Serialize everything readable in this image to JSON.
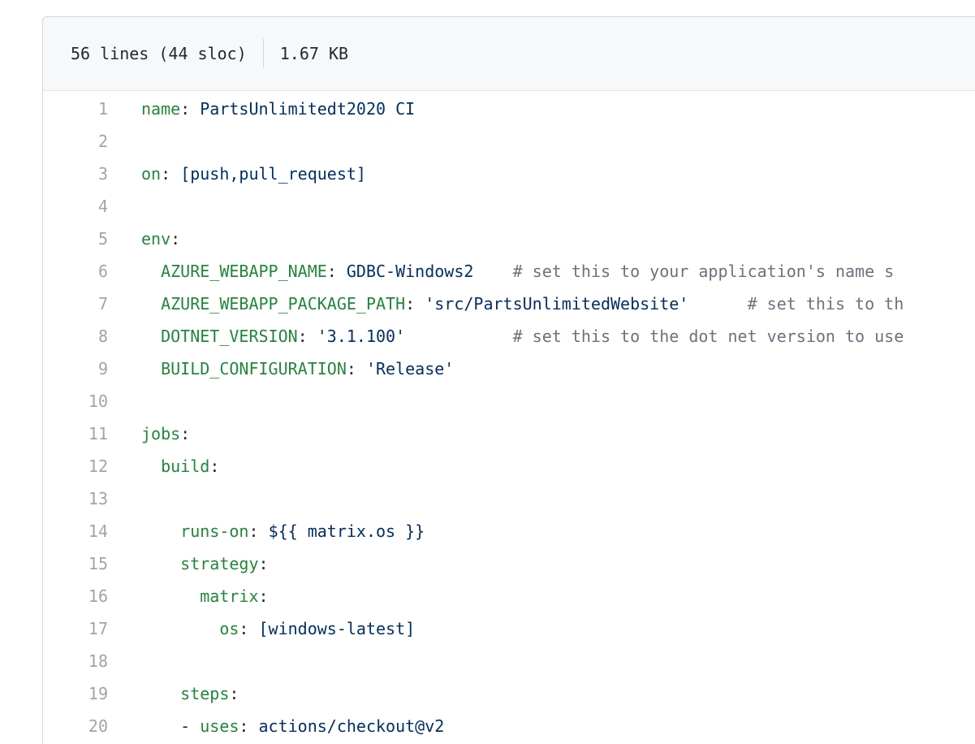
{
  "file_info": {
    "lines_sloc": "56 lines (44 sloc)",
    "size": "1.67 KB"
  },
  "colors": {
    "key": "#22863a",
    "string": "#032f62",
    "comment": "#6a737d",
    "line_number": "#a0a4a9",
    "header_bg": "#f6f8fa"
  },
  "lines": [
    {
      "n": "1",
      "indent": "",
      "key": "name",
      "sep": ": ",
      "val": "PartsUnlimitedt2020 CI",
      "comment": ""
    },
    {
      "n": "2",
      "indent": "",
      "key": "",
      "sep": "",
      "val": "",
      "comment": ""
    },
    {
      "n": "3",
      "indent": "",
      "key": "on",
      "sep": ": ",
      "val": "[push,pull_request]",
      "comment": ""
    },
    {
      "n": "4",
      "indent": "",
      "key": "",
      "sep": "",
      "val": "",
      "comment": ""
    },
    {
      "n": "5",
      "indent": "",
      "key": "env",
      "sep": ":",
      "val": "",
      "comment": ""
    },
    {
      "n": "6",
      "indent": "  ",
      "key": "AZURE_WEBAPP_NAME",
      "sep": ": ",
      "val": "GDBC-Windows2    ",
      "comment": "# set this to your application's name s"
    },
    {
      "n": "7",
      "indent": "  ",
      "key": "AZURE_WEBAPP_PACKAGE_PATH",
      "sep": ": ",
      "val": "'src/PartsUnlimitedWebsite'      ",
      "comment": "# set this to th"
    },
    {
      "n": "8",
      "indent": "  ",
      "key": "DOTNET_VERSION",
      "sep": ": ",
      "val": "'3.1.100'           ",
      "comment": "# set this to the dot net version to use"
    },
    {
      "n": "9",
      "indent": "  ",
      "key": "BUILD_CONFIGURATION",
      "sep": ": ",
      "val": "'Release'",
      "comment": ""
    },
    {
      "n": "10",
      "indent": "",
      "key": "",
      "sep": "",
      "val": "",
      "comment": ""
    },
    {
      "n": "11",
      "indent": "",
      "key": "jobs",
      "sep": ":",
      "val": "",
      "comment": ""
    },
    {
      "n": "12",
      "indent": "  ",
      "key": "build",
      "sep": ":",
      "val": "",
      "comment": ""
    },
    {
      "n": "13",
      "indent": "",
      "key": "",
      "sep": "",
      "val": "",
      "comment": ""
    },
    {
      "n": "14",
      "indent": "    ",
      "key": "runs-on",
      "sep": ": ",
      "val": "${{ matrix.os }}",
      "comment": ""
    },
    {
      "n": "15",
      "indent": "    ",
      "key": "strategy",
      "sep": ":",
      "val": "",
      "comment": ""
    },
    {
      "n": "16",
      "indent": "      ",
      "key": "matrix",
      "sep": ":",
      "val": "",
      "comment": ""
    },
    {
      "n": "17",
      "indent": "        ",
      "key": "os",
      "sep": ": ",
      "val": "[windows-latest]",
      "comment": ""
    },
    {
      "n": "18",
      "indent": "",
      "key": "",
      "sep": "",
      "val": "",
      "comment": ""
    },
    {
      "n": "19",
      "indent": "    ",
      "key": "steps",
      "sep": ":",
      "val": "",
      "comment": ""
    },
    {
      "n": "20",
      "indent": "    - ",
      "key": "uses",
      "sep": ": ",
      "val": "actions/checkout@v2",
      "comment": ""
    }
  ]
}
